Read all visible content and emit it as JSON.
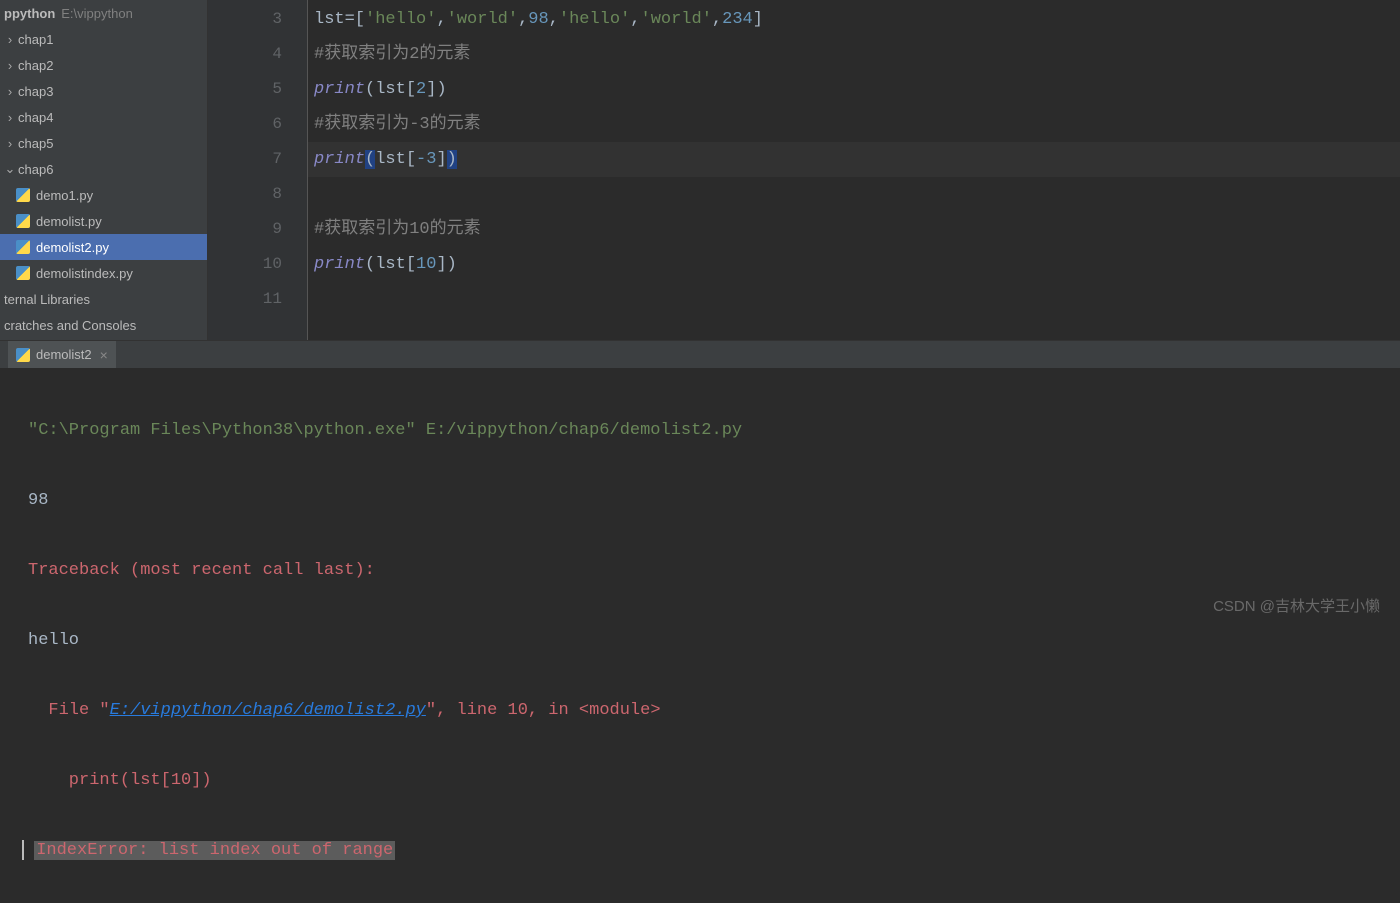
{
  "sidebar": {
    "project": {
      "name": "ppython",
      "path": "E:\\vippython"
    },
    "chaps": [
      "chap1",
      "chap2",
      "chap3",
      "chap4",
      "chap5",
      "chap6"
    ],
    "files": [
      "demo1.py",
      "demolist.py",
      "demolist2.py",
      "demolistindex.py"
    ],
    "selected_file": "demolist2.py",
    "bottom": [
      "ternal Libraries",
      "cratches and Consoles"
    ]
  },
  "editor": {
    "line_numbers": [
      "3",
      "4",
      "5",
      "6",
      "7",
      "8",
      "9",
      "10",
      "11"
    ],
    "code": {
      "l3_var": "lst",
      "l3_assign": "=[",
      "l3_s1": "'hello'",
      "l3_c1": ",",
      "l3_s2": "'world'",
      "l3_c2": ",",
      "l3_n1": "98",
      "l3_c3": ",",
      "l3_s3": "'hello'",
      "l3_c4": ",",
      "l3_s4": "'world'",
      "l3_c5": ",",
      "l3_n2": "234",
      "l3_close": "]",
      "l4_comment": "#获取索引为2的元素",
      "l5_print": "print",
      "l5_open": "(",
      "l5_var": "lst",
      "l5_lb": "[",
      "l5_num": "2",
      "l5_rb": "]",
      "l5_close": ")",
      "l6_comment": "#获取索引为-3的元素",
      "l7_print": "print",
      "l7_open": "(",
      "l7_var": "lst",
      "l7_lb": "[",
      "l7_num": "-3",
      "l7_rb": "]",
      "l7_close": ")",
      "l9_comment": "#获取索引为10的元素",
      "l10_print": "print",
      "l10_open": "(",
      "l10_var": "lst",
      "l10_lb": "[",
      "l10_num": "10",
      "l10_rb": "]",
      "l10_close": ")"
    }
  },
  "run": {
    "tab_name": "demolist2"
  },
  "console": {
    "cmd": "\"C:\\Program Files\\Python38\\python.exe\" E:/vippython/chap6/demolist2.py",
    "out1": "98",
    "trace": "Traceback (most recent call last):",
    "out2": "hello",
    "file_pre": "  File ",
    "file_quote": "\"",
    "file_path": "E:/vippython/chap6/demolist2.py",
    "file_loc": ", line 10, in <module>",
    "code_line": "    print(lst[10])",
    "error": "IndexError: list index out of range"
  },
  "watermark": "CSDN @吉林大学王小懒"
}
